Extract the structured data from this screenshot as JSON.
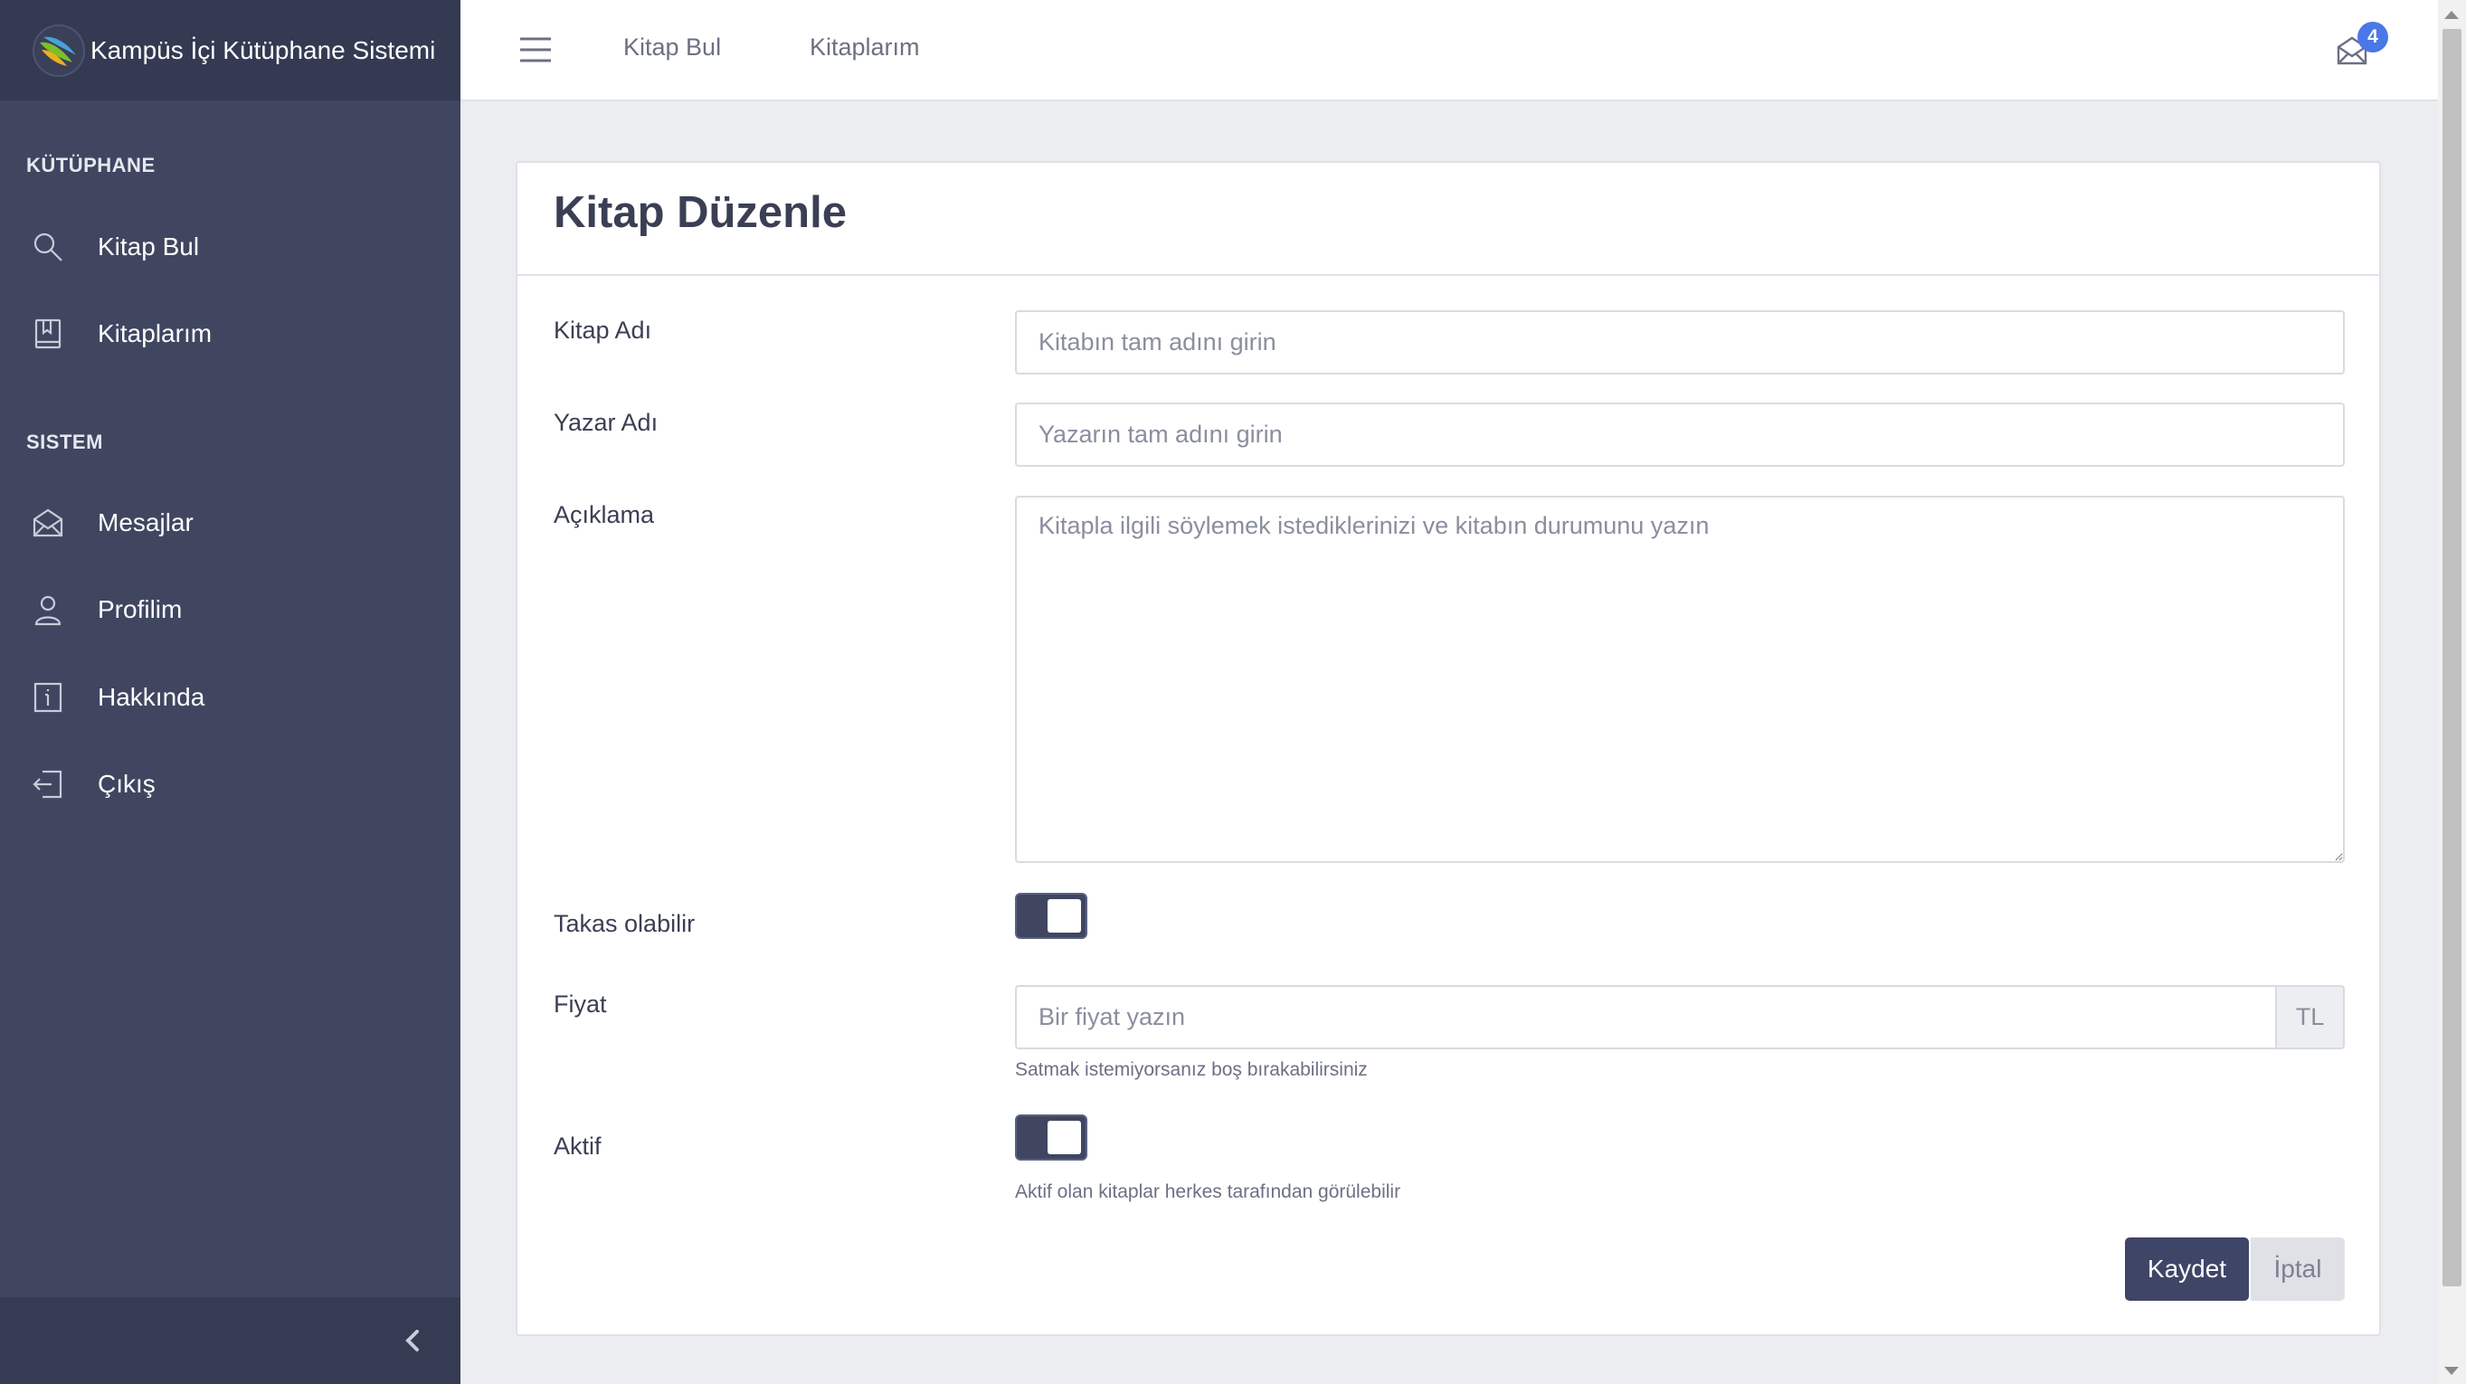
{
  "app": {
    "title": "Kampüs İçi Kütüphane Sistemi"
  },
  "sidebar": {
    "sections": [
      {
        "title": "KÜTÜPHANE",
        "items": [
          {
            "label": "Kitap Bul",
            "icon": "search-icon"
          },
          {
            "label": "Kitaplarım",
            "icon": "bookmark-book-icon"
          }
        ]
      },
      {
        "title": "SISTEM",
        "items": [
          {
            "label": "Mesajlar",
            "icon": "envelope-icon"
          },
          {
            "label": "Profilim",
            "icon": "user-icon"
          },
          {
            "label": "Hakkında",
            "icon": "info-icon"
          },
          {
            "label": "Çıkış",
            "icon": "logout-icon"
          }
        ]
      }
    ],
    "collapse_icon": "chevron-left-icon"
  },
  "topbar": {
    "menu_icon": "hamburger-icon",
    "links": [
      "Kitap Bul",
      "Kitaplarım"
    ],
    "mail_icon": "envelope-icon",
    "mail_badge": "4"
  },
  "form": {
    "title": "Kitap Düzenle",
    "fields": {
      "book_name": {
        "label": "Kitap Adı",
        "placeholder": "Kitabın tam adını girin",
        "value": ""
      },
      "author_name": {
        "label": "Yazar Adı",
        "placeholder": "Yazarın tam adını girin",
        "value": ""
      },
      "description": {
        "label": "Açıklama",
        "placeholder": "Kitapla ilgili söylemek istediklerinizi ve kitabın durumunu yazın",
        "value": ""
      },
      "exchangeable": {
        "label": "Takas olabilir",
        "checked": true
      },
      "price": {
        "label": "Fiyat",
        "placeholder": "Bir fiyat yazın",
        "value": "",
        "addon": "TL",
        "help": "Satmak istemiyorsanız boş bırakabilirsiniz"
      },
      "active": {
        "label": "Aktif",
        "checked": true,
        "help": "Aktif olan kitaplar herkes tarafından görülebilir"
      }
    },
    "buttons": {
      "save": "Kaydet",
      "cancel": "İptal"
    }
  },
  "colors": {
    "sidebar_bg": "#404660",
    "sidebar_brand_bg": "#343a52",
    "primary": "#3f4566",
    "badge": "#4a78e8",
    "page_bg": "#ebedf0"
  }
}
